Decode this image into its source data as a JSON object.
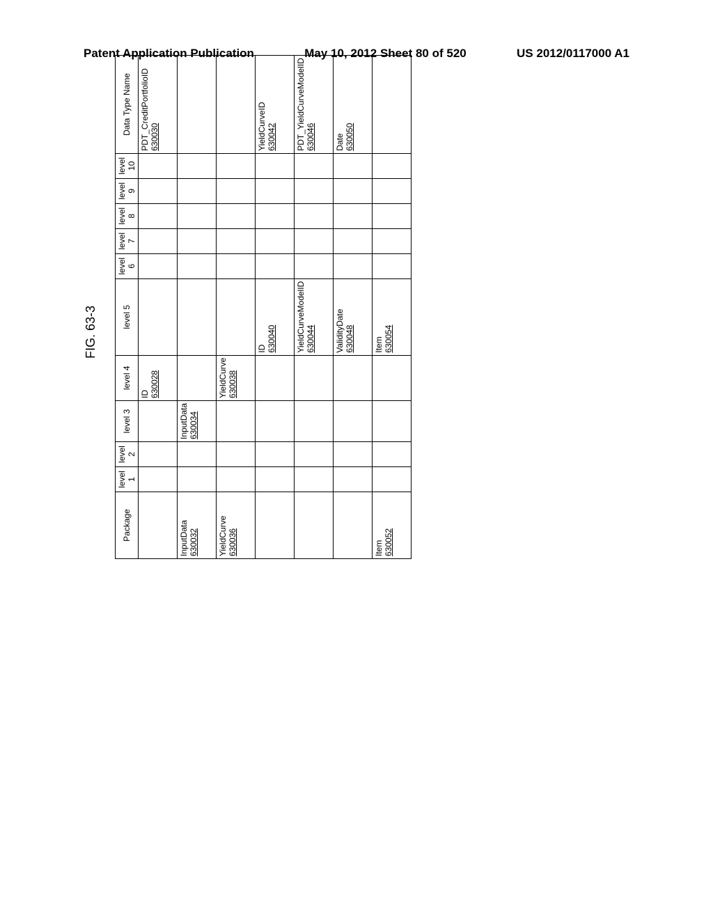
{
  "header": {
    "left": "Patent Application Publication",
    "center": "May 10, 2012  Sheet 80 of 520",
    "right": "US 2012/0117000 A1"
  },
  "figure_label": "FIG. 63-3",
  "columns": {
    "package": "Package",
    "l1": "level 1",
    "l2": "level 2",
    "l3": "level 3",
    "l4": "level 4",
    "l5": "level 5",
    "l6": "level 6",
    "l7": "level 7",
    "l8": "level 8",
    "l9": "level 9",
    "l10": "level 10",
    "dtn": "Data Type Name"
  },
  "rows": [
    {
      "package": "",
      "l1": "",
      "l2": "",
      "l3": "",
      "l4": "ID",
      "l5": "",
      "l6": "",
      "l7": "",
      "l8": "",
      "l9": "",
      "l10": "",
      "dtn": "PDT_CreditPortfolioID"
    },
    {
      "package": "",
      "l1": "",
      "l2": "",
      "l3": "",
      "l4_ref": "630028",
      "l5": "",
      "l6": "",
      "l7": "",
      "l8": "",
      "l9": "",
      "l10": "",
      "dtn_ref": "630030"
    },
    {
      "package": "InputData",
      "l1": "",
      "l2": "",
      "l3": "InputData",
      "l4": "",
      "l5": "",
      "l6": "",
      "l7": "",
      "l8": "",
      "l9": "",
      "l10": "",
      "dtn": ""
    },
    {
      "package_ref": "630032",
      "l1": "",
      "l2": "",
      "l3_ref": "630034",
      "l4": "",
      "l5": "",
      "l6": "",
      "l7": "",
      "l8": "",
      "l9": "",
      "l10": "",
      "dtn": ""
    },
    {
      "package": "YieldCurve",
      "l1": "",
      "l2": "",
      "l3": "",
      "l4": "YieldCurve",
      "l5": "",
      "l6": "",
      "l7": "",
      "l8": "",
      "l9": "",
      "l10": "",
      "dtn": ""
    },
    {
      "package_ref": "630036",
      "l1": "",
      "l2": "",
      "l3": "",
      "l4_ref": "630038",
      "l5": "",
      "l6": "",
      "l7": "",
      "l8": "",
      "l9": "",
      "l10": "",
      "dtn": ""
    },
    {
      "package": "",
      "l1": "",
      "l2": "",
      "l3": "",
      "l4": "",
      "l5": "ID",
      "l6": "",
      "l7": "",
      "l8": "",
      "l9": "",
      "l10": "",
      "dtn": "YieldCurveID"
    },
    {
      "package": "",
      "l1": "",
      "l2": "",
      "l3": "",
      "l4": "",
      "l5_ref": "630040",
      "l6": "",
      "l7": "",
      "l8": "",
      "l9": "",
      "l10": "",
      "dtn_ref": "630042"
    },
    {
      "package": "",
      "l1": "",
      "l2": "",
      "l3": "",
      "l4": "",
      "l5": "YieldCurveModelID",
      "l6": "",
      "l7": "",
      "l8": "",
      "l9": "",
      "l10": "",
      "dtn": "PDT_YieldCurveModelID"
    },
    {
      "package": "",
      "l1": "",
      "l2": "",
      "l3": "",
      "l4": "",
      "l5_ref": "630044",
      "l6": "",
      "l7": "",
      "l8": "",
      "l9": "",
      "l10": "",
      "dtn_ref": "630046"
    },
    {
      "package": "",
      "l1": "",
      "l2": "",
      "l3": "",
      "l4": "",
      "l5": "ValidityDate",
      "l6": "",
      "l7": "",
      "l8": "",
      "l9": "",
      "l10": "",
      "dtn": "Date"
    },
    {
      "package": "",
      "l1": "",
      "l2": "",
      "l3": "",
      "l4": "",
      "l5_ref": "630048",
      "l6": "",
      "l7": "",
      "l8": "",
      "l9": "",
      "l10": "",
      "dtn_ref": "630050"
    },
    {
      "package": "Item",
      "l1": "",
      "l2": "",
      "l3": "",
      "l4": "",
      "l5": "Item",
      "l6": "",
      "l7": "",
      "l8": "",
      "l9": "",
      "l10": "",
      "dtn": ""
    },
    {
      "package_ref": "630052",
      "l1": "",
      "l2": "",
      "l3": "",
      "l4": "",
      "l5_ref": "630054",
      "l6": "",
      "l7": "",
      "l8": "",
      "l9": "",
      "l10": "",
      "dtn": ""
    }
  ]
}
